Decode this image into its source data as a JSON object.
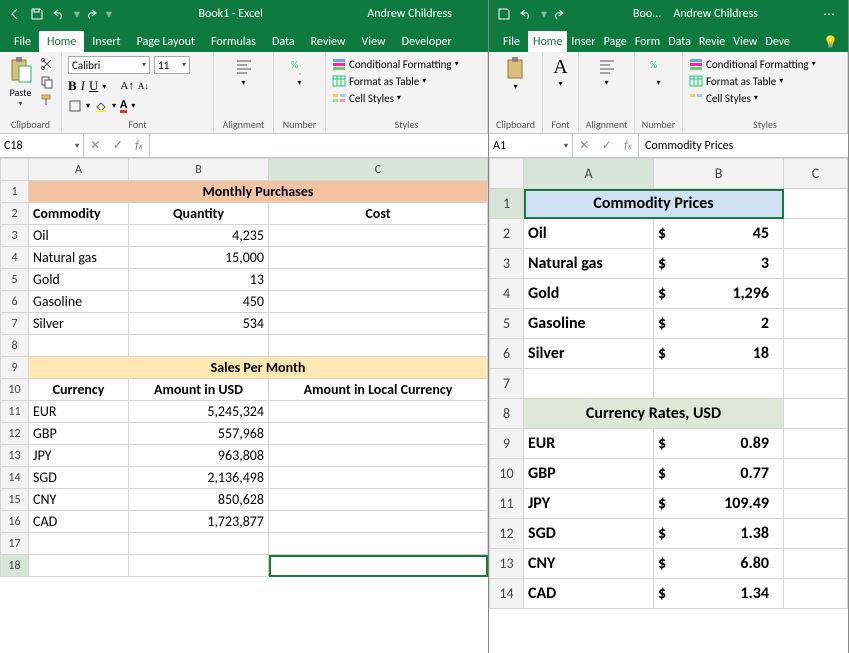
{
  "left": {
    "title": "Book1 - Excel",
    "user": "Andrew Childress",
    "menu": {
      "file": "File"
    },
    "tabs": [
      "Home",
      "Insert",
      "Page Layout",
      "Formulas",
      "Data",
      "Review",
      "View",
      "Developer"
    ],
    "active_tab": 0,
    "groups": {
      "clipboard": "Clipboard",
      "paste": "Paste",
      "font": "Font",
      "font_name": "Calibri",
      "font_size": "11",
      "alignment": "Alignment",
      "number": "Number",
      "styles": "Styles",
      "cond_fmt": "Conditional Formatting",
      "fmt_table": "Format as Table",
      "cell_styles": "Cell Styles"
    },
    "namebox": "C18",
    "formula": "",
    "cols": [
      "A",
      "B",
      "C"
    ],
    "rows": 18,
    "table1": {
      "title": "Monthly Purchases",
      "headers": [
        "Commodity",
        "Quantity",
        "Cost"
      ],
      "rows": [
        {
          "a": "Oil",
          "b": "4,235",
          "c": ""
        },
        {
          "a": "Natural gas",
          "b": "15,000",
          "c": ""
        },
        {
          "a": "Gold",
          "b": "13",
          "c": ""
        },
        {
          "a": "Gasoline",
          "b": "450",
          "c": ""
        },
        {
          "a": "Silver",
          "b": "534",
          "c": ""
        }
      ]
    },
    "table2": {
      "title": "Sales Per Month",
      "headers": [
        "Currency",
        "Amount in USD",
        "Amount in Local Currency"
      ],
      "rows": [
        {
          "a": "EUR",
          "b": "5,245,324",
          "c": ""
        },
        {
          "a": "GBP",
          "b": "557,968",
          "c": ""
        },
        {
          "a": "JPY",
          "b": "963,808",
          "c": ""
        },
        {
          "a": "SGD",
          "b": "2,136,498",
          "c": ""
        },
        {
          "a": "CNY",
          "b": "850,628",
          "c": ""
        },
        {
          "a": "CAD",
          "b": "1,723,877",
          "c": ""
        }
      ]
    },
    "selected": {
      "row": 18,
      "col": "C"
    }
  },
  "right": {
    "title": "Boo...",
    "user": "Andrew Childress",
    "menu": {
      "file": "File"
    },
    "tabs": [
      "Home",
      "Inser",
      "Page",
      "Form",
      "Data",
      "Revie",
      "View",
      "Deve"
    ],
    "active_tab": 0,
    "groups": {
      "clipboard": "Clipboard",
      "font": "Font",
      "alignment": "Alignment",
      "number": "Number",
      "styles": "Styles",
      "cond_fmt": "Conditional Formatting",
      "fmt_table": "Format as Table",
      "cell_styles": "Cell Styles"
    },
    "namebox": "A1",
    "formula": "Commodity Prices",
    "cols": [
      "A",
      "B",
      "C"
    ],
    "rows": 14,
    "table1": {
      "title": "Commodity Prices",
      "rows": [
        {
          "a": "Oil",
          "s": "$",
          "v": "45"
        },
        {
          "a": "Natural gas",
          "s": "$",
          "v": "3"
        },
        {
          "a": "Gold",
          "s": "$",
          "v": "1,296"
        },
        {
          "a": "Gasoline",
          "s": "$",
          "v": "2"
        },
        {
          "a": "Silver",
          "s": "$",
          "v": "18"
        }
      ]
    },
    "table2": {
      "title": "Currency Rates, USD",
      "rows": [
        {
          "a": "EUR",
          "s": "$",
          "v": "0.89"
        },
        {
          "a": "GBP",
          "s": "$",
          "v": "0.77"
        },
        {
          "a": "JPY",
          "s": "$",
          "v": "109.49"
        },
        {
          "a": "SGD",
          "s": "$",
          "v": "1.38"
        },
        {
          "a": "CNY",
          "s": "$",
          "v": "6.80"
        },
        {
          "a": "CAD",
          "s": "$",
          "v": "1.34"
        }
      ]
    },
    "selected": {
      "row": 1,
      "col": "A"
    }
  }
}
